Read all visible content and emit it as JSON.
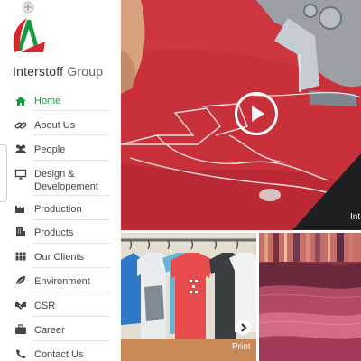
{
  "brand": {
    "name": "Interstoff",
    "suffix": "Group"
  },
  "menu": [
    {
      "label": "Home",
      "icon": "home-icon",
      "active": true
    },
    {
      "label": "About Us",
      "icon": "link-icon",
      "active": false
    },
    {
      "label": "People",
      "icon": "people-icon",
      "active": false
    },
    {
      "label": "Design &\nDevelopement",
      "icon": "monitor-icon",
      "active": false
    },
    {
      "label": "Production",
      "icon": "factory-icon",
      "active": false
    },
    {
      "label": "Products",
      "icon": "building-icon",
      "active": false
    },
    {
      "label": "Our Clients",
      "icon": "group-icon",
      "active": false
    },
    {
      "label": "Environment",
      "icon": "leaf-icon",
      "active": false
    },
    {
      "label": "CSR",
      "icon": "handshake-icon",
      "active": false
    },
    {
      "label": "Career",
      "icon": "briefcase-icon",
      "active": false
    },
    {
      "label": "Contact Us",
      "icon": "phone-icon",
      "active": false
    }
  ],
  "hero": {
    "caption": "Int",
    "play_icon": "play-icon"
  },
  "tiles": [
    {
      "caption": "Print",
      "icon": "chevron-right-icon"
    },
    {
      "caption": ""
    }
  ],
  "colors": {
    "accent": "#1a9a3e",
    "brand_red": "#d8262c",
    "hero_fabric": "#c8303a"
  }
}
